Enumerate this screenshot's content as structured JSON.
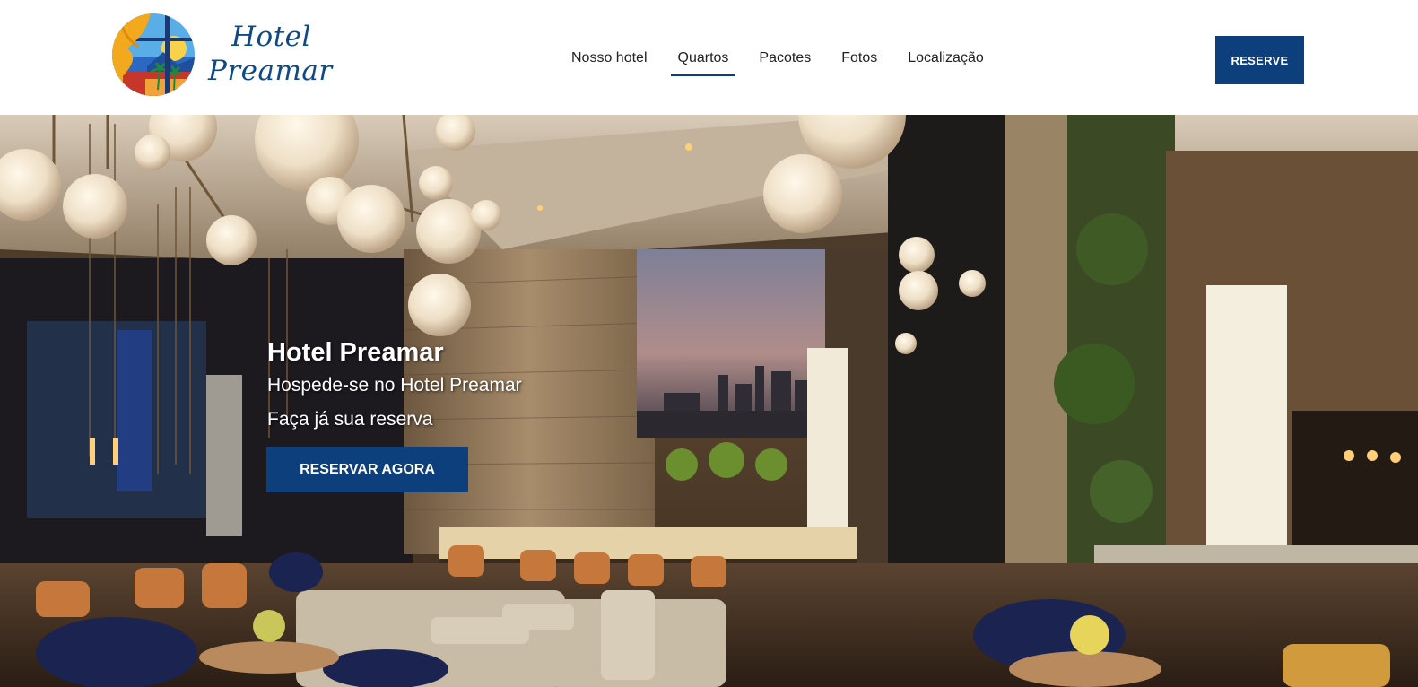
{
  "brand": {
    "line1": "Hotel",
    "line2": "Preamar",
    "logo_icon": "window-curtain-beach-icon"
  },
  "nav": {
    "items": [
      {
        "label": "Nosso hotel",
        "active": false
      },
      {
        "label": "Quartos",
        "active": true
      },
      {
        "label": "Pacotes",
        "active": false
      },
      {
        "label": "Fotos",
        "active": false
      },
      {
        "label": "Localização",
        "active": false
      }
    ]
  },
  "header": {
    "reserve_label": "RESERVE"
  },
  "hero": {
    "title": "Hotel Preamar",
    "line1": "Hospede-se no Hotel Preamar",
    "line2": "Faça já sua reserva",
    "cta_label": "RESERVAR AGORA",
    "image": "hotel-lounge-bar-photo"
  },
  "colors": {
    "primary": "#0c3f7c",
    "brand_text": "#0f4a86",
    "nav_text": "#222222",
    "header_bg": "#ffffff"
  }
}
